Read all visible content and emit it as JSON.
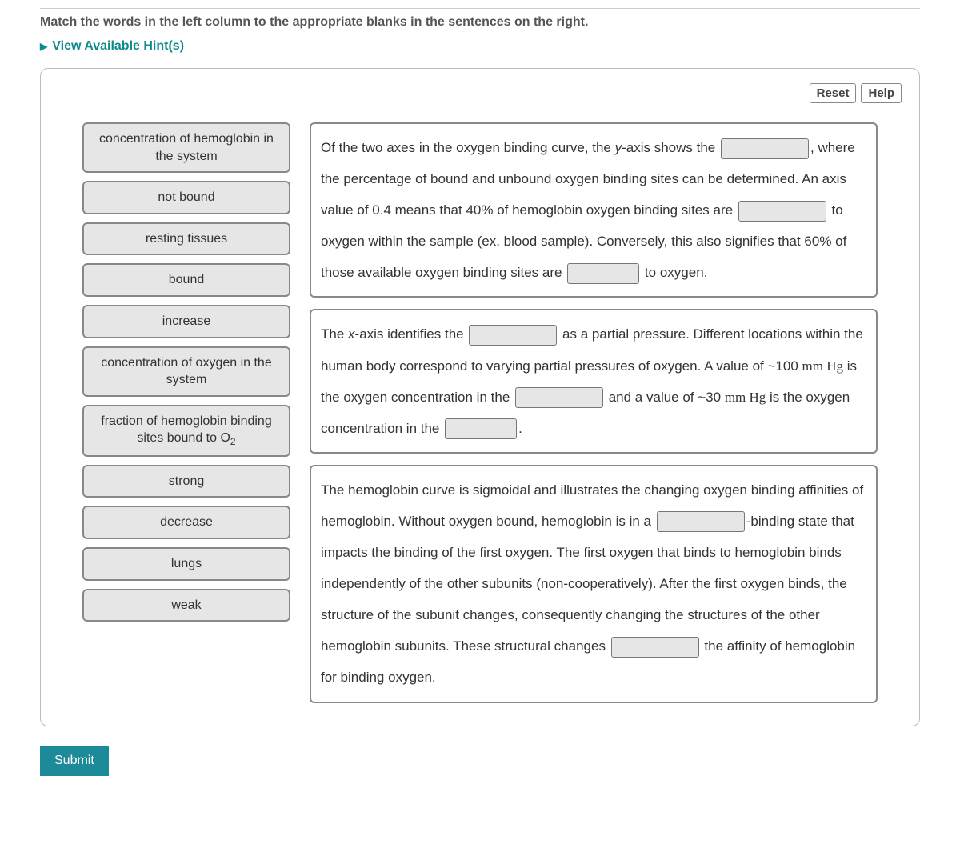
{
  "instructions": "Match the words in the left column to the appropriate blanks in the sentences on the right.",
  "hints_label": "View Available Hint(s)",
  "toolbar": {
    "reset": "Reset",
    "help": "Help"
  },
  "words": [
    "concentration of hemoglobin in the system",
    "not bound",
    "resting tissues",
    "bound",
    "increase",
    "concentration of oxygen in the system",
    "fraction of hemoglobin binding sites bound to O₂",
    "strong",
    "decrease",
    "lungs",
    "weak"
  ],
  "sentences": {
    "s1": {
      "t1": "Of the two axes in the oxygen binding curve, the ",
      "t1b": "y",
      "t1c": "-axis shows the ",
      "t2": ", where the percentage of bound and unbound oxygen binding sites can be determined. An axis value of 0.4 means that 40% of hemoglobin oxygen binding sites are ",
      "t3": " to oxygen within the sample (ex. blood sample). Conversely, this also signifies that 60% of those available oxygen binding sites are ",
      "t4": " to oxygen."
    },
    "s2": {
      "t1": "The ",
      "t1b": "x",
      "t1c": "-axis identifies the ",
      "t2": " as a partial pressure. Different locations within the human body correspond to varying partial pressures of oxygen. A value of ~100 ",
      "t2u": "mm Hg",
      "t2d": " is the oxygen concentration in the ",
      "t3": " and a value of ~30 ",
      "t3u": "mm Hg",
      "t3d": " is the oxygen concentration in the ",
      "t4": "."
    },
    "s3": {
      "t1": "The hemoglobin curve is sigmoidal and illustrates the changing oxygen binding affinities of hemoglobin. Without oxygen bound, hemoglobin is in a ",
      "t2": "-binding state that impacts the binding of the first oxygen. The first oxygen that binds to hemoglobin binds independently of the other subunits (non-cooperatively). After the first oxygen binds, the structure of the subunit changes, consequently changing the structures of the other hemoglobin subunits. These structural changes ",
      "t3": " the affinity of hemoglobin for binding oxygen."
    }
  },
  "submit": "Submit"
}
